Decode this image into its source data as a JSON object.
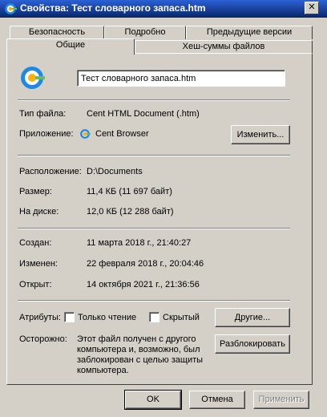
{
  "window": {
    "title": "Свойства: Тест словарного запаса.htm",
    "close_glyph": "✕"
  },
  "tabs_back": [
    "Безопасность",
    "Подробно",
    "Предыдущие версии"
  ],
  "tabs_front": [
    "Общие",
    "Хеш-суммы файлов"
  ],
  "general": {
    "file_name": "Тест словарного запаса.htm",
    "file_type_label": "Тип файла:",
    "file_type_value": "Cent HTML Document (.htm)",
    "app_label": "Приложение:",
    "app_value": "Cent Browser",
    "change_button": "Изменить...",
    "location_label": "Расположение:",
    "location_value": "D:\\Documents",
    "size_label": "Размер:",
    "size_value": "11,4 КБ (11 697 байт)",
    "disk_label": "На диске:",
    "disk_value": "12,0 КБ (12 288 байт)",
    "created_label": "Создан:",
    "created_value": "11 марта 2018 г., 21:40:27",
    "modified_label": "Изменен:",
    "modified_value": "22 февраля 2018 г., 20:04:46",
    "opened_label": "Открыт:",
    "opened_value": "14 октября 2021 г., 21:36:56",
    "attributes_label": "Атрибуты:",
    "readonly_label": "Только чтение",
    "hidden_label": "Скрытый",
    "other_button": "Другие...",
    "caution_label": "Осторожно:",
    "caution_text": "Этот файл получен с другого компьютера и, возможно, был заблокирован с целью защиты компьютера.",
    "unblock_button": "Разблокировать"
  },
  "footer": {
    "ok": "OK",
    "cancel": "Отмена",
    "apply": "Применить"
  },
  "colors": {
    "titlebar_start": "#2a61d6",
    "titlebar_end": "#0a246a",
    "face": "#d4d0c8",
    "app_ring": "#1e88e5",
    "app_center": "#ffb300"
  }
}
